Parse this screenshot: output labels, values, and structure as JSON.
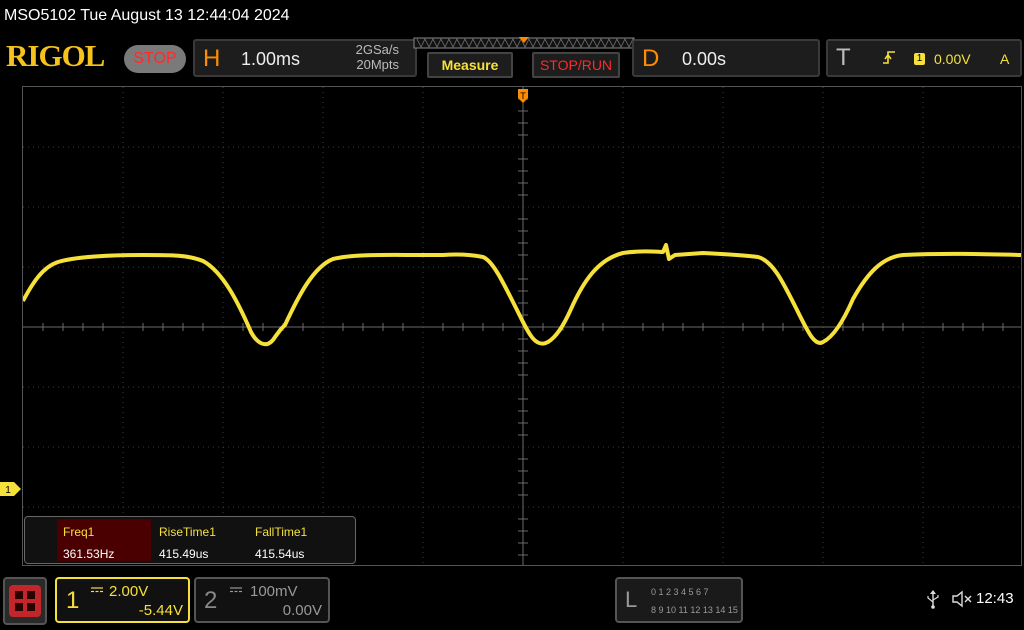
{
  "title_bar": "MSO5102  Tue August 13 12:44:04 2024",
  "brand": "RIGOL",
  "status_button": "STOP",
  "horizontal": {
    "letter": "H",
    "timebase": "1.00ms",
    "sample_rate": "2GSa/s",
    "memory_depth": "20Mpts"
  },
  "buttons": {
    "measure": "Measure",
    "stop_run": "STOP/RUN"
  },
  "delay": {
    "letter": "D",
    "value": "0.00s"
  },
  "trigger": {
    "letter": "T",
    "source": "1",
    "level": "0.00V",
    "mode": "A"
  },
  "channel_marker": "1",
  "measurements": [
    {
      "label": "Freq1",
      "value": "361.53Hz"
    },
    {
      "label": "RiseTime1",
      "value": "415.49us"
    },
    {
      "label": "FallTime1",
      "value": "415.54us"
    }
  ],
  "ch1": {
    "number": "1",
    "scale": "2.00V",
    "offset": "-5.44V",
    "color": "#f6e03a"
  },
  "ch2": {
    "number": "2",
    "scale": "100mV",
    "offset": "0.00V"
  },
  "logic": {
    "letter": "L",
    "row1": "0 1 2 3   4 5 6 7",
    "row2": "8  9 10 11  12 13 14 15"
  },
  "clock": "12:43",
  "colors": {
    "trace": "#f6e03a",
    "accent": "#ff8c00",
    "stop": "#ff2a2a"
  }
}
